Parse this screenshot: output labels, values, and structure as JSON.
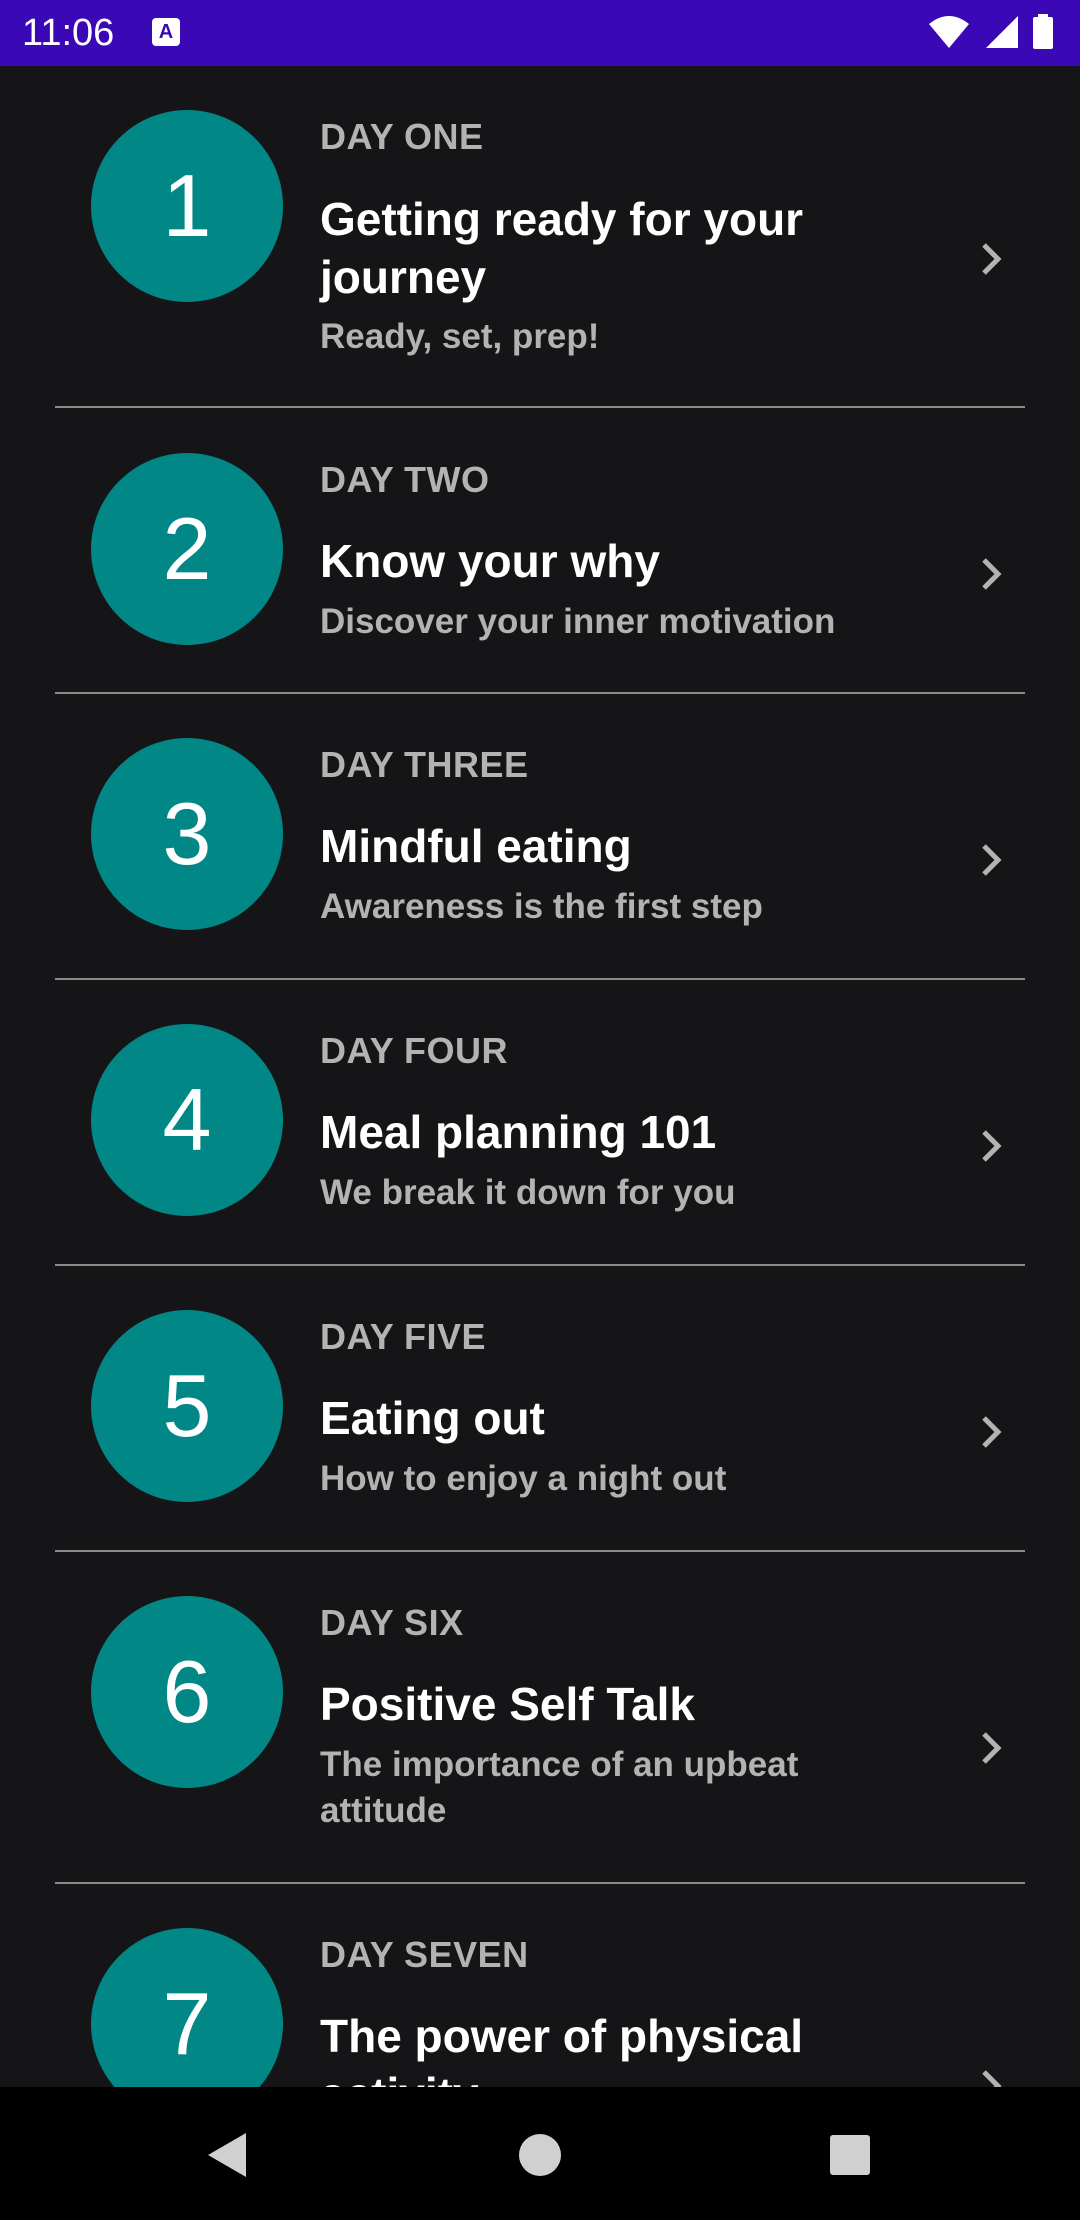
{
  "status_bar": {
    "time": "11:06",
    "app_icon_letter": "A"
  },
  "colors": {
    "status_bar": "#3a08b5",
    "background": "#151517",
    "circle": "#018786",
    "divider": "#8a8a8a"
  },
  "items": [
    {
      "number": "1",
      "day": "DAY ONE",
      "title": "Getting ready for your journey",
      "subtitle": "Ready, set, prep!"
    },
    {
      "number": "2",
      "day": "DAY TWO",
      "title": "Know your why",
      "subtitle": "Discover your inner motivation"
    },
    {
      "number": "3",
      "day": "DAY THREE",
      "title": "Mindful eating",
      "subtitle": "Awareness is the first step"
    },
    {
      "number": "4",
      "day": "DAY FOUR",
      "title": "Meal planning 101",
      "subtitle": "We break it down for you"
    },
    {
      "number": "5",
      "day": "DAY FIVE",
      "title": "Eating out",
      "subtitle": "How to enjoy a night out"
    },
    {
      "number": "6",
      "day": "DAY SIX",
      "title": "Positive Self Talk",
      "subtitle": "The importance of an upbeat attitude"
    },
    {
      "number": "7",
      "day": "DAY SEVEN",
      "title": "The power of physical activity",
      "subtitle": ""
    }
  ],
  "nav": {
    "back_icon": "back-triangle-icon",
    "home_icon": "home-circle-icon",
    "recents_icon": "recents-square-icon"
  }
}
